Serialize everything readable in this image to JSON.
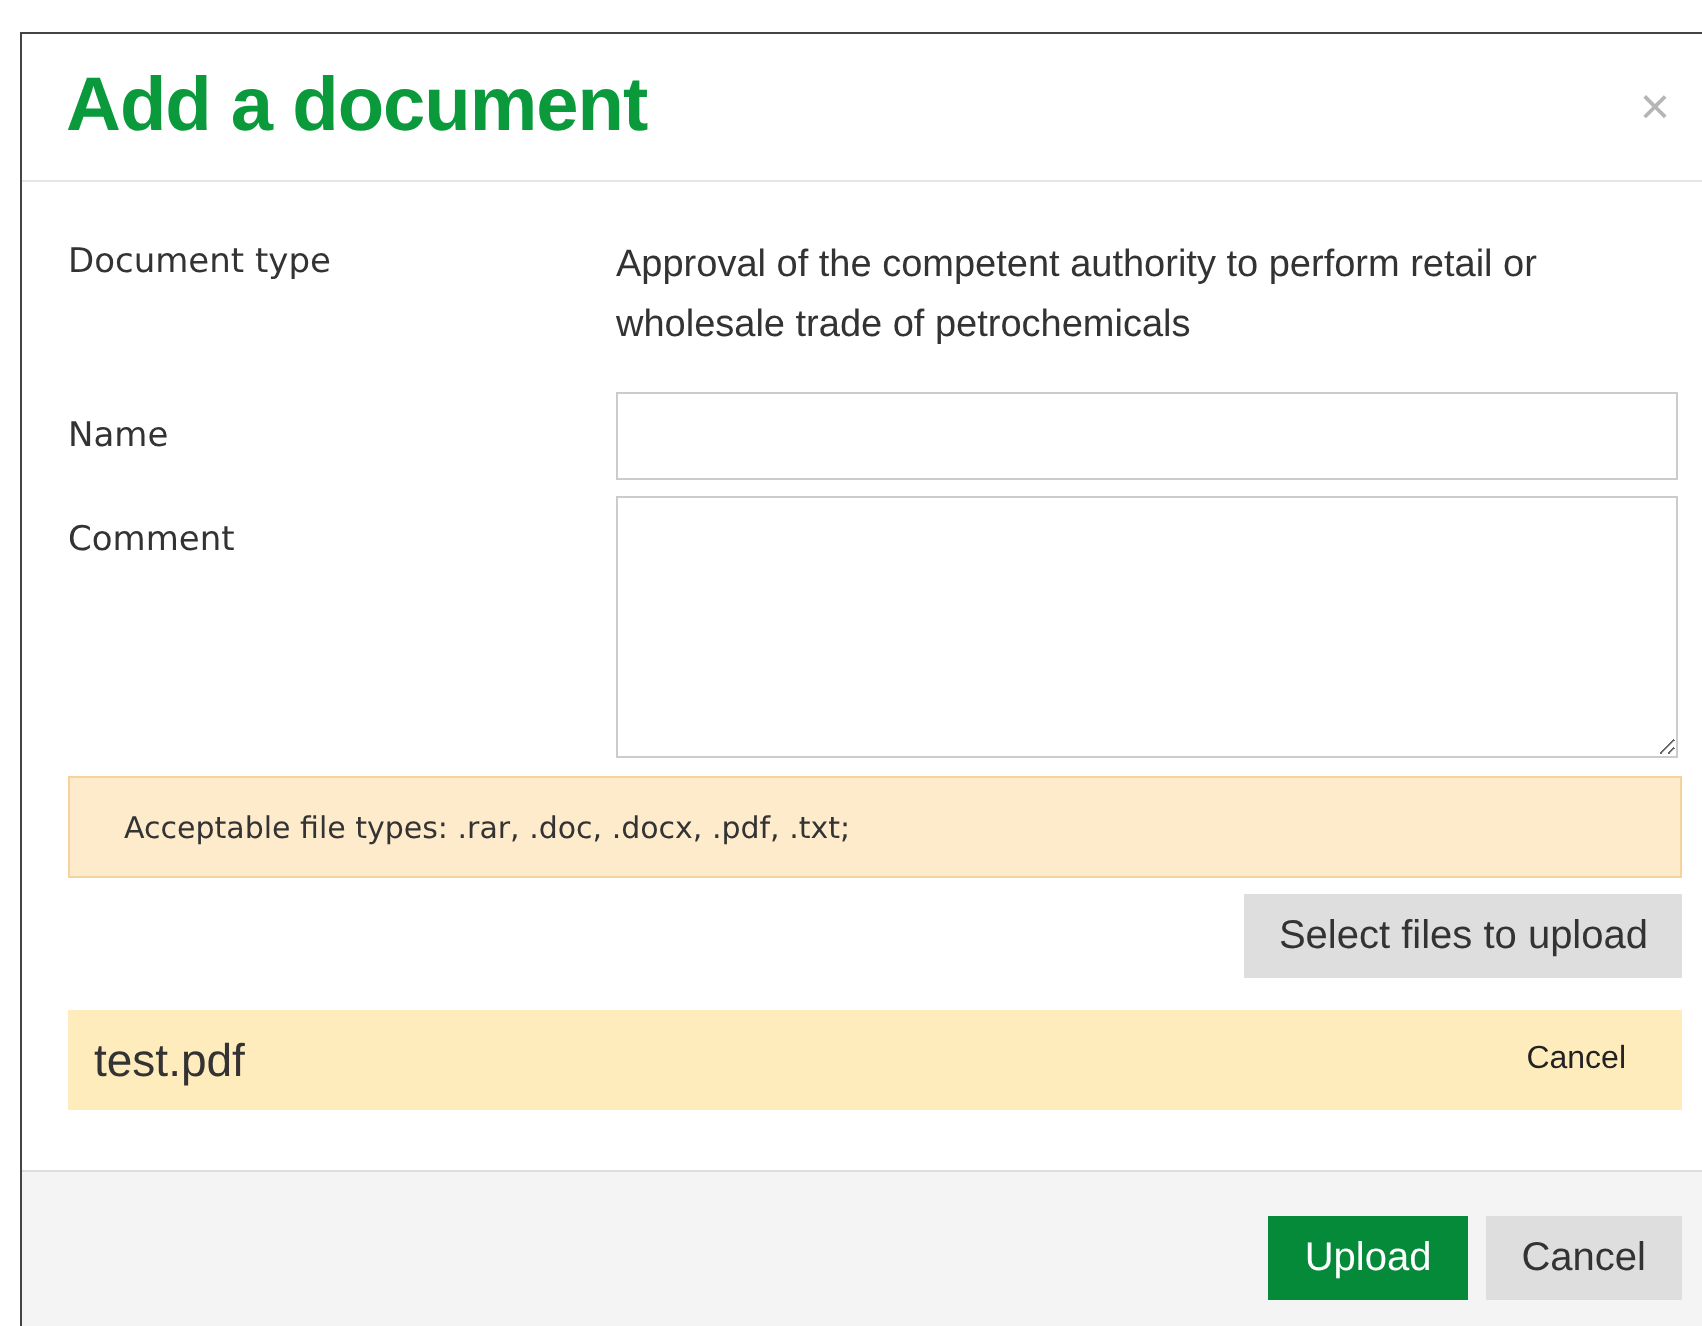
{
  "dialog": {
    "title": "Add a document",
    "close": "×"
  },
  "fields": [
    {
      "kind": "text",
      "label": "Document type",
      "value": "Approval of the competent authority to perform retail or wholesale trade of petrochemicals"
    },
    {
      "kind": "input",
      "label": "Name"
    },
    {
      "kind": "textarea",
      "label": "Comment"
    }
  ],
  "notice": "Acceptable file types: .rar, .doc, .docx, .pdf, .txt;",
  "select_button": "Select files to upload",
  "files": [
    {
      "name": "test.pdf",
      "action": "Cancel"
    }
  ],
  "footer_buttons": [
    {
      "label": "Upload",
      "kind": "primary"
    },
    {
      "label": "Cancel",
      "kind": "secondary"
    }
  ]
}
